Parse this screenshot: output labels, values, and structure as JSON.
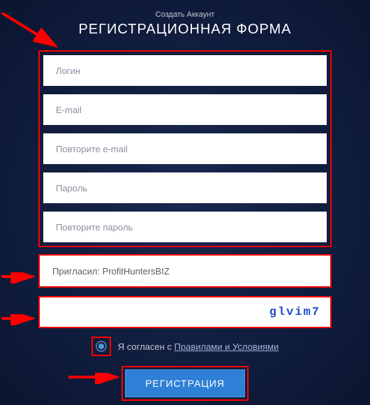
{
  "header": {
    "subtitle": "Создать Аккаунт",
    "title": "РЕГИСТРАЦИОННАЯ ФОРМА"
  },
  "fields": {
    "login": {
      "placeholder": "Логин",
      "value": ""
    },
    "email": {
      "placeholder": "E-mail",
      "value": ""
    },
    "email_confirm": {
      "placeholder": "Повторите e-mail",
      "value": ""
    },
    "password": {
      "placeholder": "Пароль",
      "value": ""
    },
    "password_confirm": {
      "placeholder": "Повторите пароль",
      "value": ""
    }
  },
  "referrer": {
    "text": "Пригласил: ProfitHuntersBIZ"
  },
  "captcha": {
    "code": "glvim7"
  },
  "agreement": {
    "prefix": "Я согласен с ",
    "link": "Правилами и Условиями"
  },
  "submit": {
    "label": "РЕГИСТРАЦИЯ"
  }
}
